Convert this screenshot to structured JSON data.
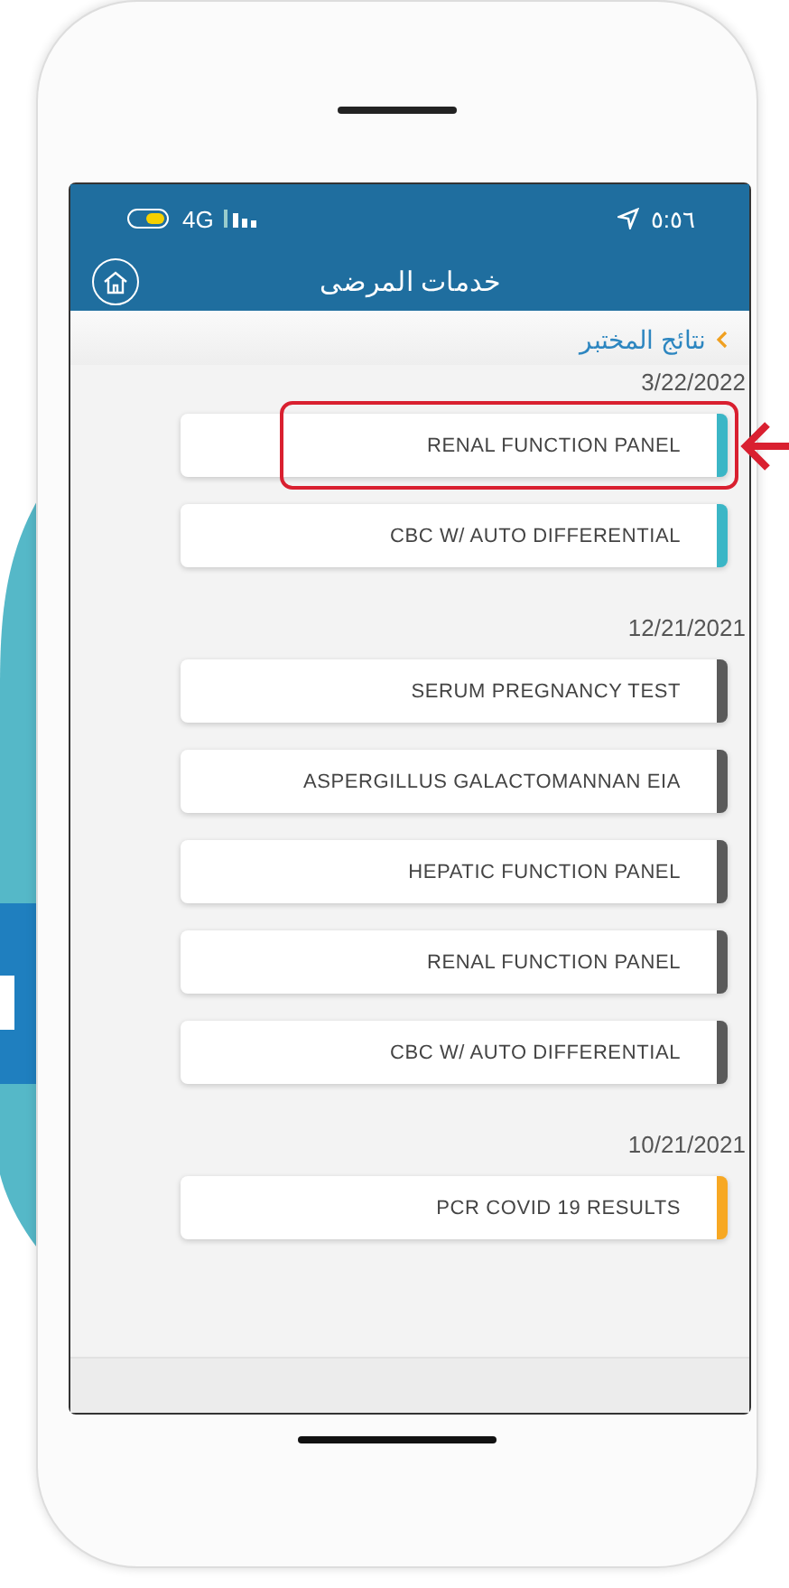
{
  "status_bar": {
    "network": "4G",
    "time": "٥:٥٦"
  },
  "header": {
    "title": "خدمات المرضى"
  },
  "breadcrumb": {
    "label": "نتائج المختبر"
  },
  "groups": [
    {
      "date": "3/22/2022",
      "results": [
        {
          "name": "RENAL FUNCTION PANEL",
          "color": "#3bb6c6",
          "highlighted": true
        },
        {
          "name": "CBC W/ AUTO DIFFERENTIAL",
          "color": "#3bb6c6",
          "highlighted": false
        }
      ]
    },
    {
      "date": "12/21/2021",
      "results": [
        {
          "name": "SERUM PREGNANCY TEST",
          "color": "#5a5a5a",
          "highlighted": false
        },
        {
          "name": "ASPERGILLUS GALACTOMANNAN EIA",
          "color": "#5a5a5a",
          "highlighted": false
        },
        {
          "name": "HEPATIC FUNCTION PANEL",
          "color": "#5a5a5a",
          "highlighted": false
        },
        {
          "name": "RENAL FUNCTION PANEL",
          "color": "#5a5a5a",
          "highlighted": false
        },
        {
          "name": "CBC W/ AUTO DIFFERENTIAL",
          "color": "#5a5a5a",
          "highlighted": false
        }
      ]
    },
    {
      "date": "10/21/2021",
      "results": [
        {
          "name": "PCR COVID 19 RESULTS",
          "color": "#f7a823",
          "highlighted": false
        }
      ]
    }
  ]
}
